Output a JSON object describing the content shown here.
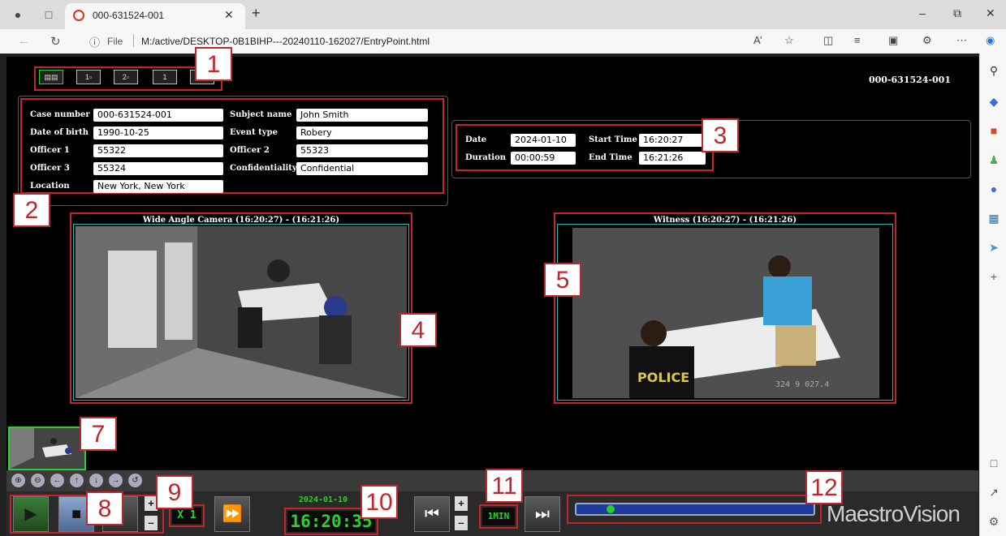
{
  "browser": {
    "tab_title": "000-631524-001",
    "url_label": "File",
    "url": "M:/active/DESKTOP-0B1BIHP---20240110-162027/EntryPoint.html"
  },
  "app": {
    "case_id_header": "000-631524-001",
    "layout_buttons": [
      "dual",
      "1+",
      "2+",
      "1",
      "full"
    ],
    "metadata": {
      "case_number_label": "Case number",
      "case_number": "000-631524-001",
      "subject_name_label": "Subject name",
      "subject_name": "John Smith",
      "dob_label": "Date of birth",
      "dob": "1990-10-25",
      "event_type_label": "Event type",
      "event_type": "Robery",
      "officer1_label": "Officer 1",
      "officer1": "55322",
      "officer2_label": "Officer 2",
      "officer2": "55323",
      "officer3_label": "Officer 3",
      "officer3": "55324",
      "confidentiality_label": "Confidentiality",
      "confidentiality": "Confidential",
      "location_label": "Location",
      "location": "New York, New York"
    },
    "timing": {
      "date_label": "Date",
      "date": "2024-01-10",
      "start_label": "Start Time",
      "start": "16:20:27",
      "duration_label": "Duration",
      "duration": "00:00:59",
      "end_label": "End Time",
      "end": "16:21:26"
    },
    "cameras": [
      {
        "title": "Wide Angle Camera (16:20:27) - (16:21:26)"
      },
      {
        "title": "Witness (16:20:27) - (16:21:26)",
        "overlay": "324 9 027.4"
      }
    ],
    "transport": {
      "speed": "X 1",
      "lcd_date": "2024-01-10",
      "lcd_time": "16:20:35",
      "step_unit": "1MIN",
      "progress": 0.13
    },
    "brand": "MaestroVision",
    "callouts": [
      "1",
      "2",
      "3",
      "4",
      "5",
      "7",
      "8",
      "9",
      "10",
      "11",
      "12"
    ],
    "colors": {
      "highlight": "#c0262b",
      "lcd_green": "#2cd02c",
      "cam_border": "#2bb7b7"
    }
  }
}
